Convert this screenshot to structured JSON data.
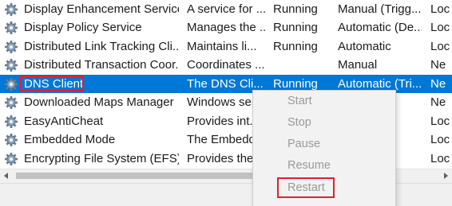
{
  "services": [
    {
      "name": "Display Enhancement Service",
      "description": "A service for ...",
      "status": "Running",
      "startup_type": "Manual (Trigg...",
      "log_on_as": "Loc"
    },
    {
      "name": "Display Policy Service",
      "description": "Manages the ...",
      "status": "Running",
      "startup_type": "Automatic (De...",
      "log_on_as": "Loc"
    },
    {
      "name": "Distributed Link Tracking Cli...",
      "description": "Maintains li...",
      "status": "Running",
      "startup_type": "Automatic",
      "log_on_as": "Loc"
    },
    {
      "name": "Distributed Transaction Coor...",
      "description": "Coordinates ...",
      "status": "",
      "startup_type": "Manual",
      "log_on_as": "Ne"
    },
    {
      "name": "DNS Client",
      "description": "The DNS Cli...",
      "status": "Running",
      "startup_type": "Automatic (Tri...",
      "log_on_as": "Ne",
      "selected": true
    },
    {
      "name": "Downloaded Maps Manager",
      "description": "Windows ser...",
      "status": "",
      "startup_type": "",
      "log_on_as": "Ne"
    },
    {
      "name": "EasyAntiCheat",
      "description": "Provides int...",
      "status": "",
      "startup_type": "",
      "log_on_as": "Loc"
    },
    {
      "name": "Embedded Mode",
      "description": "The Embedd...",
      "status": "",
      "startup_type": "",
      "log_on_as": "Loc"
    },
    {
      "name": "Encrypting File System (EFS)",
      "description": "Provides the...",
      "status": "",
      "startup_type": "",
      "log_on_as": "Loc"
    }
  ],
  "context_menu": {
    "items": [
      "Start",
      "Stop",
      "Pause",
      "Resume",
      "Restart"
    ],
    "highlighted": "Restart"
  },
  "colors": {
    "selection": "#0078d7",
    "highlight_box": "#e0202e",
    "disabled_text": "#9a9a9a",
    "menu_background": "#f2f2f2"
  },
  "icons": {
    "service": "gear-icon"
  }
}
